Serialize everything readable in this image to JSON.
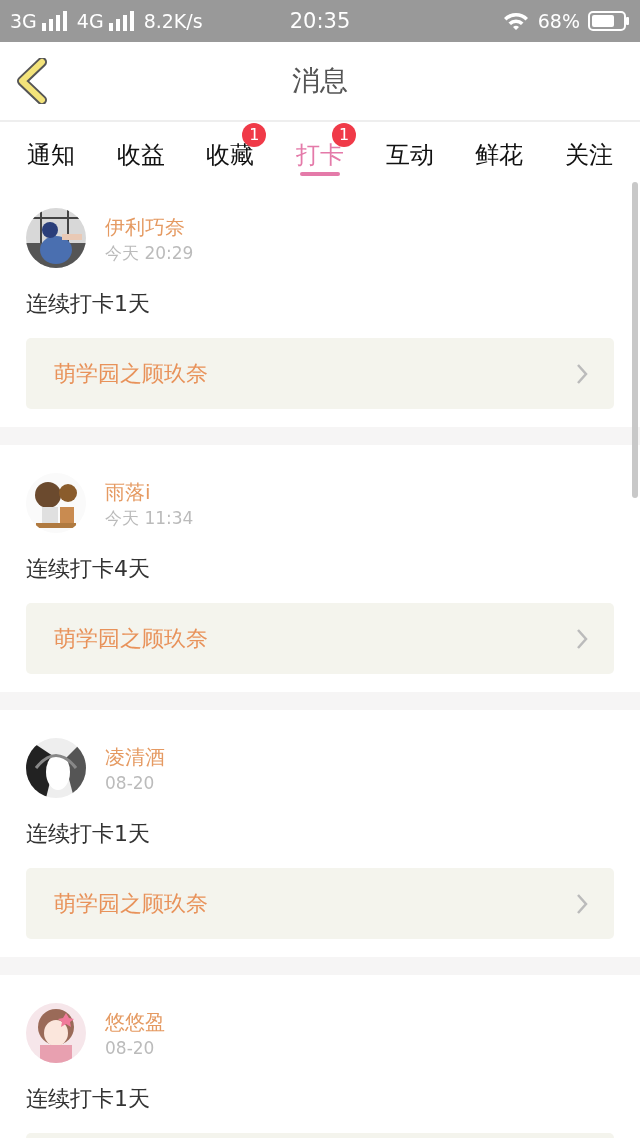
{
  "status_bar": {
    "network_1": "3G",
    "network_2": "4G",
    "speed": "8.2K/s",
    "time": "20:35",
    "battery": "68%"
  },
  "header": {
    "title": "消息"
  },
  "tabs": [
    {
      "label": "通知",
      "selected": false
    },
    {
      "label": "收益",
      "selected": false
    },
    {
      "label": "收藏",
      "selected": false,
      "badge": "1"
    },
    {
      "label": "打卡",
      "selected": true,
      "badge": "1"
    },
    {
      "label": "互动",
      "selected": false
    },
    {
      "label": "鲜花",
      "selected": false
    },
    {
      "label": "关注",
      "selected": false
    }
  ],
  "posts": [
    {
      "name": "伊利巧奈",
      "time": "今天 20:29",
      "text": "连续打卡1天",
      "link": "萌学园之顾玖奈"
    },
    {
      "name": "雨落i",
      "time": "今天 11:34",
      "text": "连续打卡4天",
      "link": "萌学园之顾玖奈"
    },
    {
      "name": "凌清酒",
      "time": "08-20",
      "text": "连续打卡1天",
      "link": "萌学园之顾玖奈"
    },
    {
      "name": "悠悠盈",
      "time": "08-20",
      "text": "连续打卡1天"
    }
  ]
}
